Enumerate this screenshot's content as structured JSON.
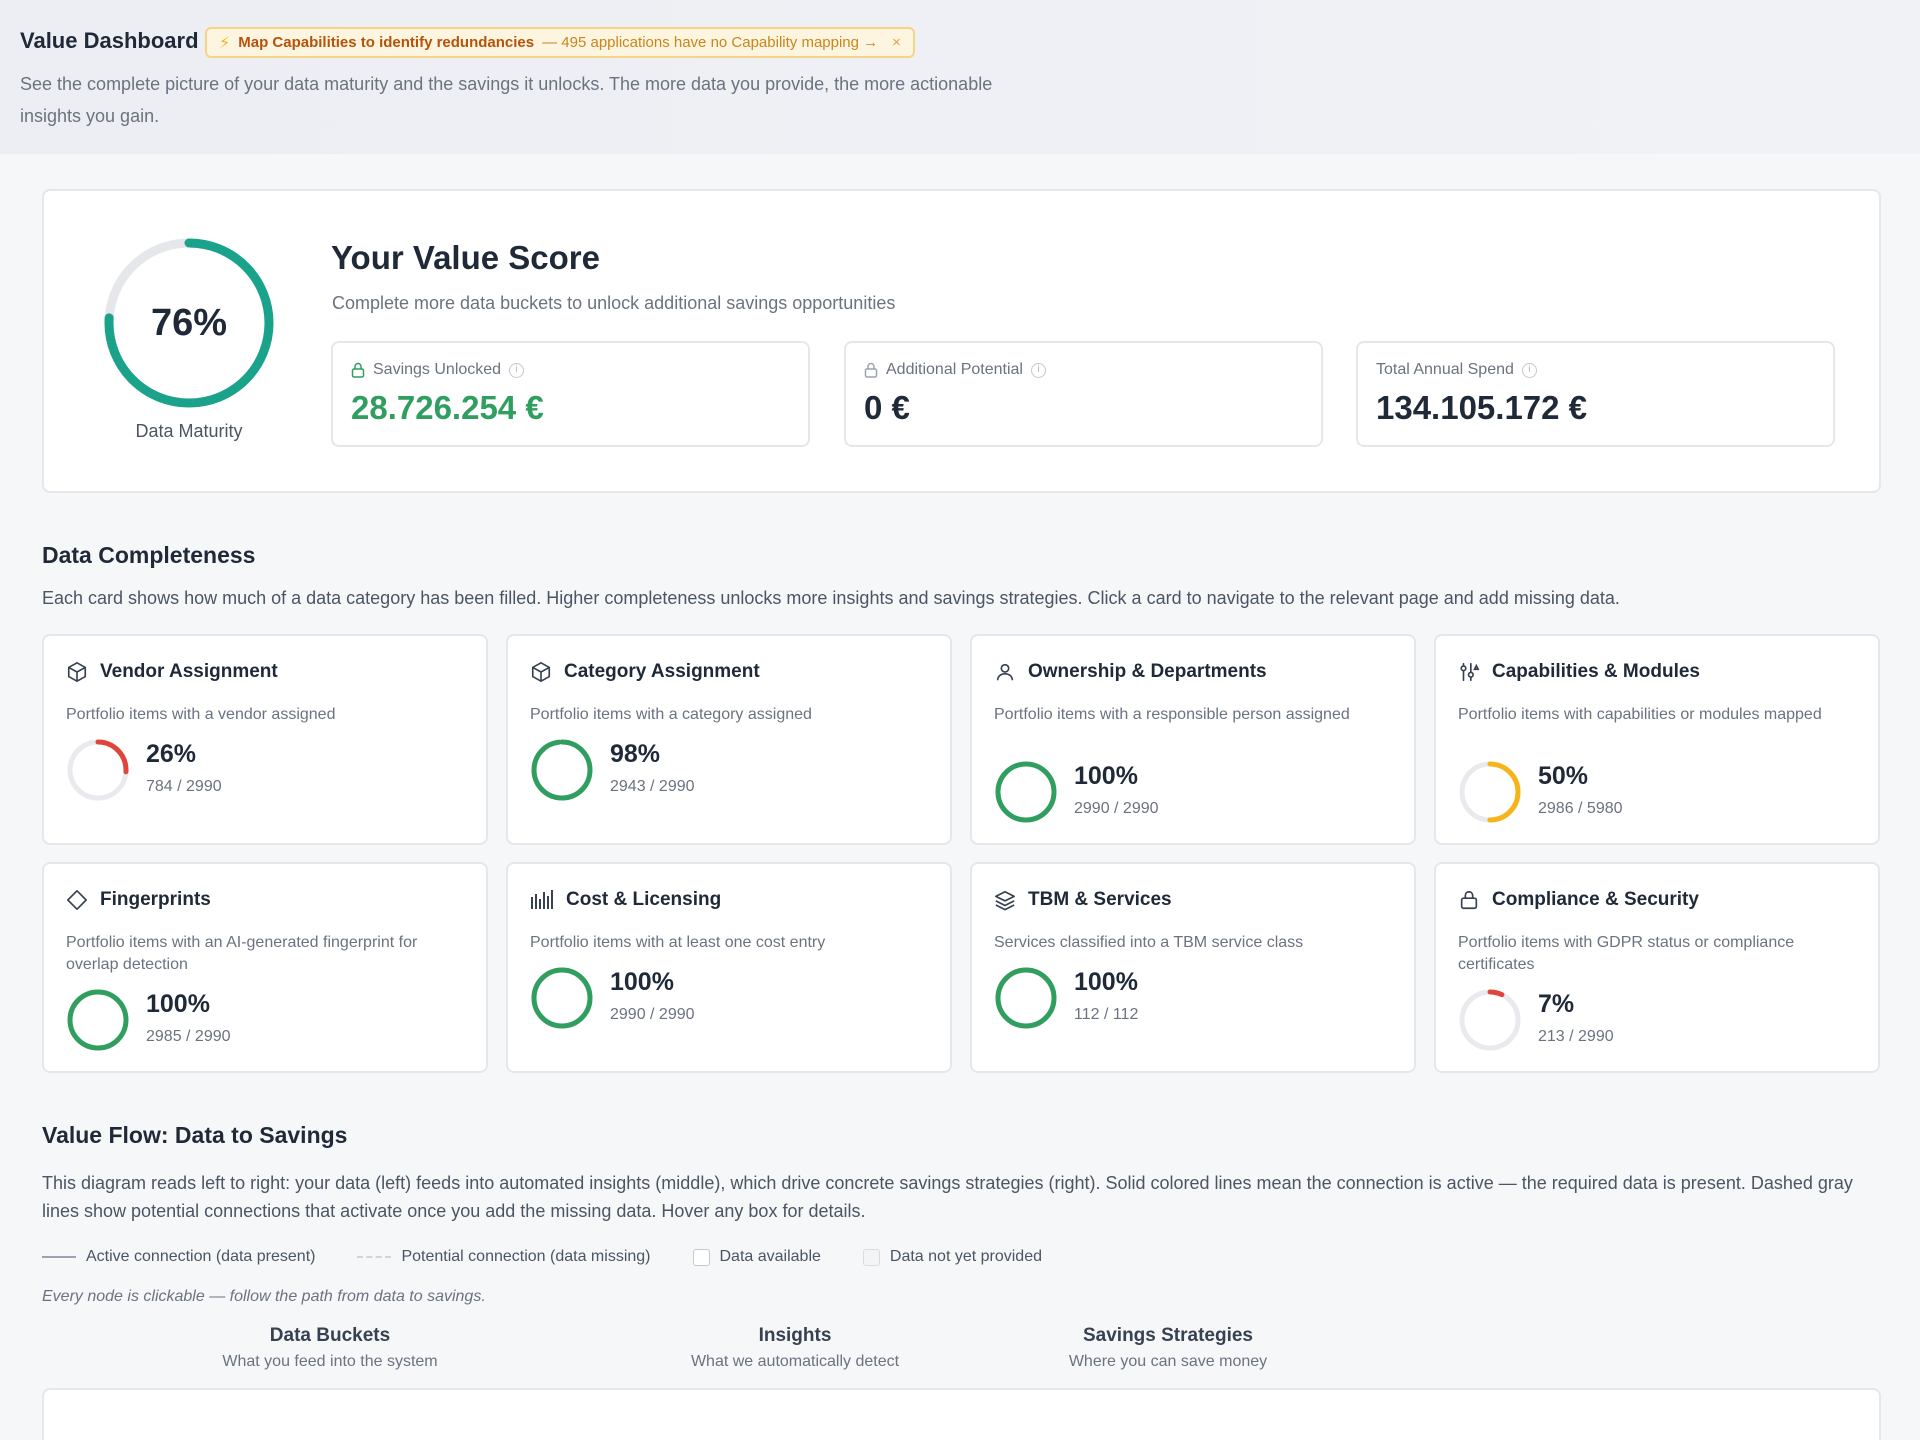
{
  "header": {
    "title": "Value Dashboard",
    "notice": {
      "strong": "Map Capabilities to identify redundancies",
      "detail": "— 495 applications have no Capability mapping →",
      "close": "×"
    },
    "subtitle": "See the complete picture of your data maturity and the savings it unlocks. The more data you provide, the more actionable insights you gain."
  },
  "score": {
    "maturity_value": "76%",
    "maturity_fraction": 0.76,
    "maturity_label": "Data Maturity",
    "title": "Your Value Score",
    "subtitle": "Complete more data buckets to unlock additional savings opportunities",
    "metrics": [
      {
        "label": "Savings Unlocked",
        "value": "28.726.254 €",
        "icon": "lock-icon"
      },
      {
        "label": "Additional Potential",
        "value": "0 €",
        "icon": "lock-icon"
      },
      {
        "label": "Total Annual Spend",
        "value": "134.105.172 €",
        "icon": "none"
      }
    ]
  },
  "completeness": {
    "title": "Data Completeness",
    "description": "Each card shows how much of a data category has been filled. Higher completeness unlocks more insights and savings strategies. Click a card to navigate to the relevant page and add missing data.",
    "cards": [
      {
        "title": "Vendor Assignment",
        "desc": "Portfolio items with a vendor assigned",
        "pct": "26%",
        "fraction": 0.26,
        "count": "784 / 2990",
        "color": "#e0453c",
        "icon": "box-icon"
      },
      {
        "title": "Category Assignment",
        "desc": "Portfolio items with a category assigned",
        "pct": "98%",
        "fraction": 0.98,
        "count": "2943 / 2990",
        "color": "#2f9e5e",
        "icon": "box-icon"
      },
      {
        "title": "Ownership & Departments",
        "desc": "Portfolio items with a responsible person assigned",
        "pct": "100%",
        "fraction": 1.0,
        "count": "2990 / 2990",
        "color": "#2f9e5e",
        "icon": "user-icon"
      },
      {
        "title": "Capabilities & Modules",
        "desc": "Portfolio items with capabilities or modules mapped",
        "pct": "50%",
        "fraction": 0.5,
        "count": "2986 / 5980",
        "color": "#f4b41a",
        "icon": "sliders-icon"
      },
      {
        "title": "Fingerprints",
        "desc": "Portfolio items with an AI-generated fingerprint for overlap detection",
        "pct": "100%",
        "fraction": 1.0,
        "count": "2985 / 2990",
        "color": "#2f9e5e",
        "icon": "diamond-icon"
      },
      {
        "title": "Cost & Licensing",
        "desc": "Portfolio items with at least one cost entry",
        "pct": "100%",
        "fraction": 1.0,
        "count": "2990 / 2990",
        "color": "#2f9e5e",
        "icon": "bars-icon"
      },
      {
        "title": "TBM & Services",
        "desc": "Services classified into a TBM service class",
        "pct": "100%",
        "fraction": 1.0,
        "count": "112 / 112",
        "color": "#2f9e5e",
        "icon": "layers-icon"
      },
      {
        "title": "Compliance & Security",
        "desc": "Portfolio items with GDPR status or compliance certificates",
        "pct": "7%",
        "fraction": 0.07,
        "count": "213 / 2990",
        "color": "#e0453c",
        "icon": "lock-icon"
      }
    ]
  },
  "flow": {
    "title": "Value Flow: Data to Savings",
    "description": "This diagram reads left to right: your data (left) feeds into automated insights (middle), which drive concrete savings strategies (right). Solid colored lines mean the connection is active — the required data is present. Dashed gray lines show potential connections that activate once you add the missing data. Hover any box for details.",
    "legend": {
      "active": "Active connection (data present)",
      "potential": "Potential connection (data missing)",
      "available": "Data available",
      "not_provided": "Data not yet provided"
    },
    "hint": "Every node is clickable — follow the path from data to savings.",
    "columns": [
      {
        "title": "Data Buckets",
        "sub": "What you feed into the system"
      },
      {
        "title": "Insights",
        "sub": "What we automatically detect"
      },
      {
        "title": "Savings Strategies",
        "sub": "Where you can save money"
      }
    ]
  },
  "colors": {
    "accent_teal": "#1aa38a",
    "green": "#2f9e5e",
    "red": "#e0453c",
    "yellow": "#f4b41a"
  }
}
